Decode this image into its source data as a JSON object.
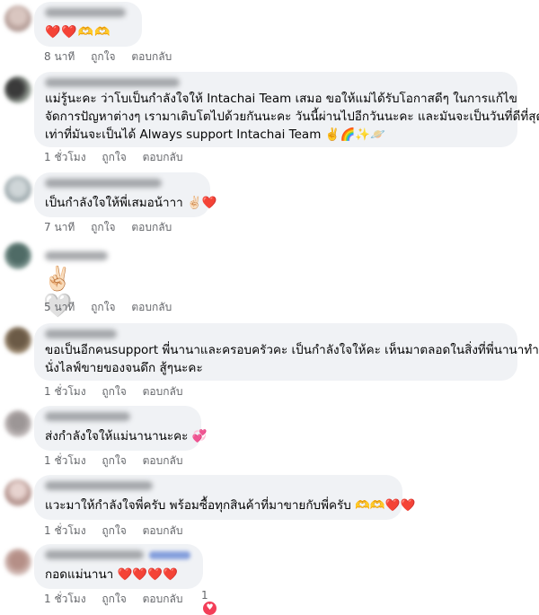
{
  "comments": [
    {
      "text": "❤️❤️🫶🫶",
      "time": "8 นาที",
      "like": "ถูกใจ",
      "reply": "ตอบกลับ"
    },
    {
      "lines": [
        "แม่รู้นะคะ ว่าโบเป็นกำลังใจให้ Intachai Team เสมอ ขอให้แม่ได้รับโอกาสดีๆ ในการแก้ไข",
        "จัดการปัญหาต่างๆ เรามาเติบโตไปด้วยกันนะคะ วันนี้ผ่านไปอีกวันนะคะ และมันจะเป็นวันที่ดีที่สุด",
        "เท่าที่มันจะเป็นได้ Always support Intachai Team ✌️🌈✨🪐"
      ],
      "time": "1 ชั่วโมง",
      "like": "ถูกใจ",
      "reply": "ตอบกลับ"
    },
    {
      "text": "เป็นกำลังใจให้พี่เสมอน้าาา ✌🏻❤️",
      "time": "7 นาที",
      "like": "ถูกใจ",
      "reply": "ตอบกลับ"
    },
    {
      "text": "✌🏻🤍",
      "time": "5 นาที",
      "like": "ถูกใจ",
      "reply": "ตอบกลับ"
    },
    {
      "lines": [
        "ขอเป็นอีกคนsupport พี่นานาและครอบครัวคะ เป็นกำลังใจให้คะ เห็นมาตลอดในสิ่งที่พี่นานาทำ",
        "นั่งไลฟ์ขายของจนดึก สู้ๆนะคะ"
      ],
      "time": "1 ชั่วโมง",
      "like": "ถูกใจ",
      "reply": "ตอบกลับ"
    },
    {
      "text": "ส่งกำลังใจให้แม่นานานะคะ 💞",
      "time": "1 ชั่วโมง",
      "like": "ถูกใจ",
      "reply": "ตอบกลับ"
    },
    {
      "text": "แวะมาให้กำลังใจพี่ครับ พร้อมซื้อทุกสินค้าที่มาขายกับพี่ครับ 🫶🫶❤️❤️",
      "time": "1 ชั่วโมง",
      "like": "ถูกใจ",
      "reply": "ตอบกลับ"
    },
    {
      "text": "กอดแม่นานา ❤️❤️❤️❤️",
      "time": "1 ชั่วโมง",
      "like": "ถูกใจ",
      "reply": "ตอบกลับ",
      "reactions": "1"
    }
  ]
}
